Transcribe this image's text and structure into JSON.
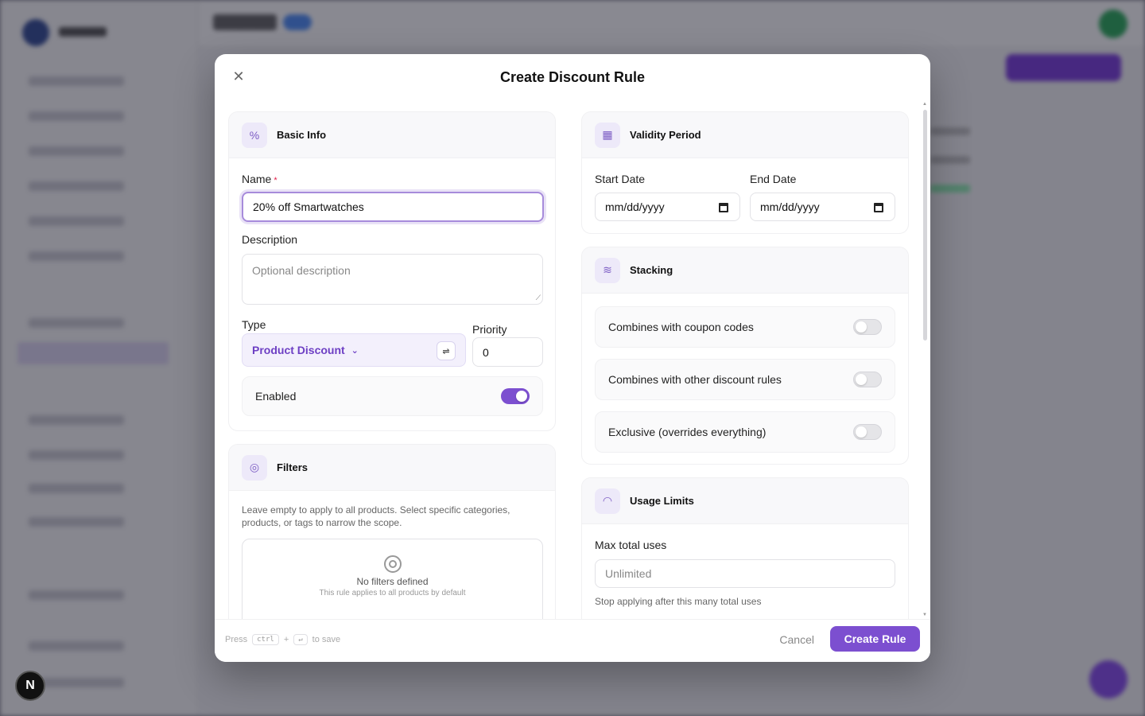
{
  "modal": {
    "title": "Create Discount Rule",
    "close_icon": "close-icon"
  },
  "basic_info": {
    "title": "Basic Info",
    "icon": "percent-icon",
    "name_label": "Name",
    "name_required_mark": "*",
    "name_value": "20% off Smartwatches",
    "description_label": "Description",
    "description_placeholder": "Optional description",
    "type_label": "Type",
    "type_value": "Product Discount",
    "priority_label": "Priority",
    "priority_value": "0",
    "enabled_label": "Enabled",
    "enabled": true
  },
  "filters": {
    "title": "Filters",
    "icon": "target-icon",
    "help": "Leave empty to apply to all products. Select specific categories, products, or tags to narrow the scope.",
    "empty_title": "No filters defined",
    "empty_sub": "This rule applies to all products by default"
  },
  "validity": {
    "title": "Validity Period",
    "icon": "calendar-icon",
    "start_label": "Start Date",
    "start_value": "mm/dd/yyyy",
    "end_label": "End Date",
    "end_value": "mm/dd/yyyy"
  },
  "stacking": {
    "title": "Stacking",
    "icon": "layers-icon",
    "options": [
      {
        "label": "Combines with coupon codes",
        "enabled": false
      },
      {
        "label": "Combines with other discount rules",
        "enabled": false
      },
      {
        "label": "Exclusive (overrides everything)",
        "enabled": false
      }
    ]
  },
  "usage": {
    "title": "Usage Limits",
    "icon": "gauge-icon",
    "max_label": "Max total uses",
    "max_placeholder": "Unlimited",
    "max_help": "Stop applying after this many total uses"
  },
  "footer": {
    "hint_press": "Press",
    "hint_key1": "ctrl",
    "hint_plus": "+",
    "hint_key2": "↵",
    "hint_save": "to save",
    "cancel_label": "Cancel",
    "create_label": "Create Rule"
  },
  "badge": {
    "letter": "N"
  },
  "colors": {
    "accent": "#7c4fd0",
    "accent_light": "#ede9f9"
  }
}
